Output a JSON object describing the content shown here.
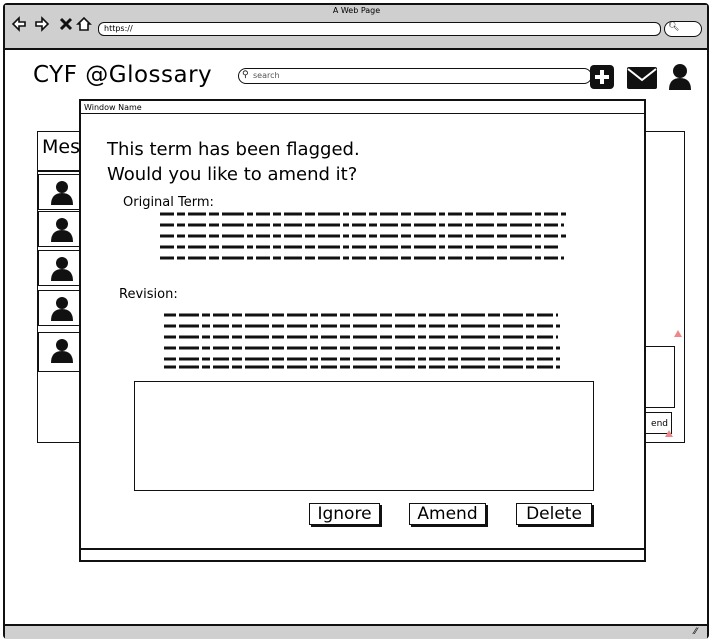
{
  "browser": {
    "window_title": "A Web Page",
    "url": "https://",
    "nav_icons": [
      "back-icon",
      "forward-icon",
      "close-icon",
      "home-icon"
    ],
    "search_icon": "search-icon"
  },
  "app": {
    "brand": "CYF @Glossary",
    "search_placeholder": "search",
    "header_icons": [
      "plus-icon",
      "mail-icon",
      "user-icon"
    ],
    "messages_header": "Mes",
    "list_items": 5,
    "send_label": "end"
  },
  "dialog": {
    "window_name": "Window Name",
    "heading_line1": "This term has been flagged.",
    "heading_line2": "Would you like to amend it?",
    "original_label": "Original Term:",
    "revision_label": "Revision:",
    "textarea_value": "",
    "buttons": {
      "ignore": "Ignore",
      "amend": "Amend",
      "delete": "Delete"
    }
  }
}
